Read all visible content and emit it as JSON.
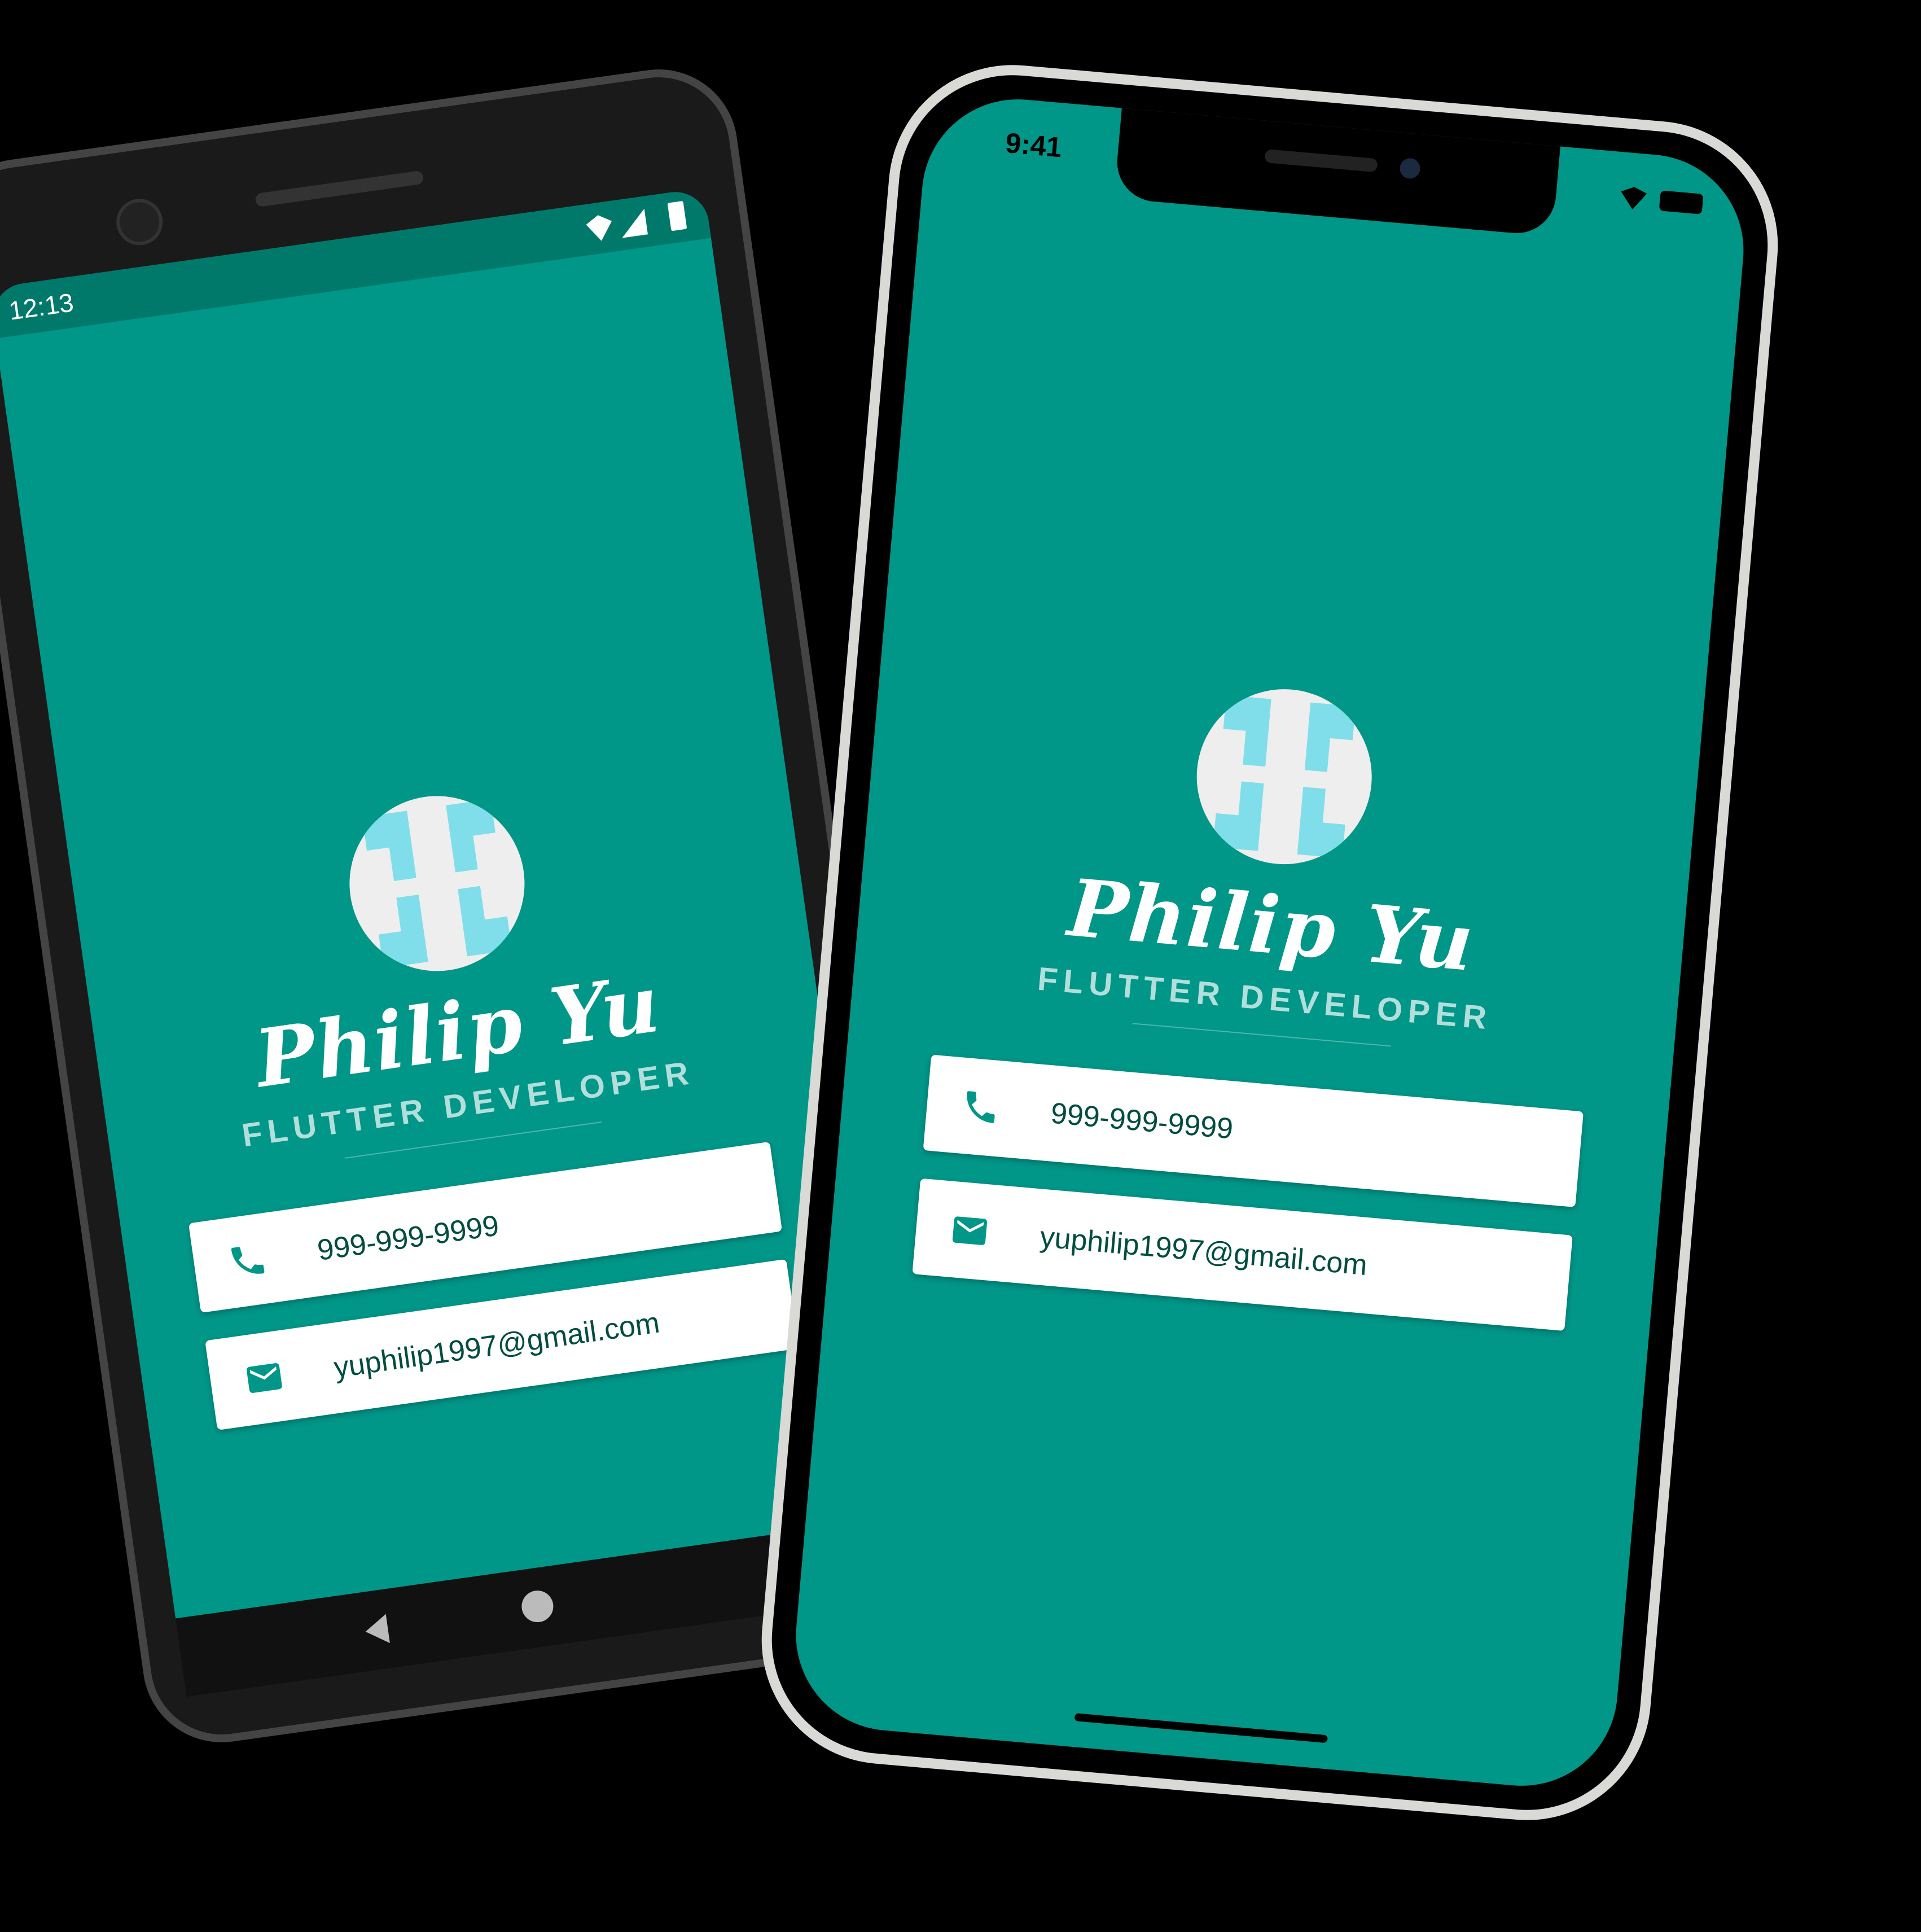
{
  "theme": {
    "background": "#009688",
    "title_color": "#b2dfdb",
    "icon_color": "#009688",
    "text_color": "#004d40",
    "avatar_bg": "#eeeeee",
    "avatar_tile": "#80deea"
  },
  "profile": {
    "name": "Philip Yu",
    "title": "FLUTTER DEVELOPER",
    "phone": "999-999-9999",
    "email": "yuphilip1997@gmail.com"
  },
  "icons": {
    "phone": "phone-icon",
    "email": "mail-icon"
  },
  "android": {
    "status_time": "12:13"
  },
  "ios": {
    "status_time": "9:41"
  }
}
